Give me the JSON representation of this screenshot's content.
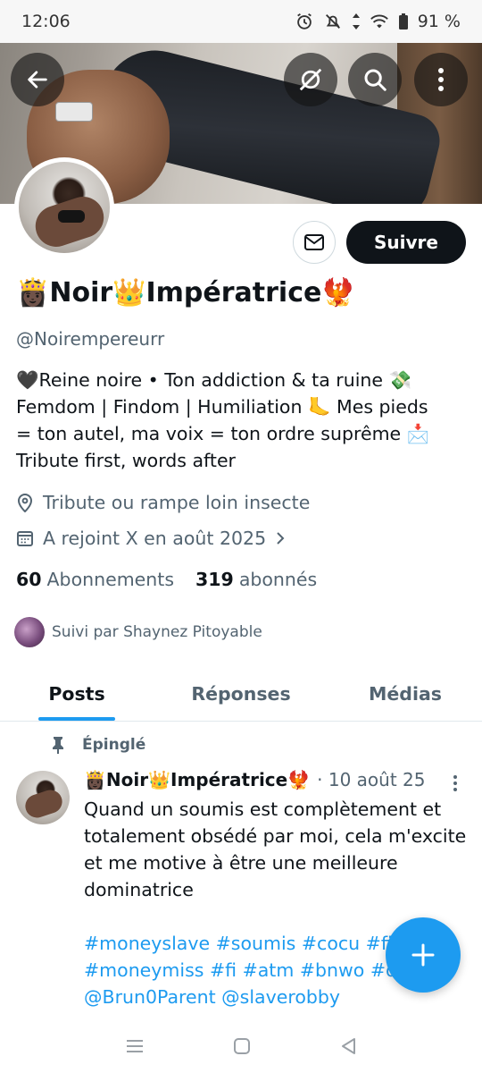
{
  "status_bar": {
    "time": "12:06",
    "battery": "91 %"
  },
  "profile": {
    "display_name": "👸🏿Noir👑Impératrice🐦‍🔥",
    "handle": "@Noirempereurr",
    "bio_lines": [
      "🖤Reine noire • Ton addiction & ta ruine 💸",
      "Femdom | Findom | Humiliation 🦶 Mes pieds",
      "= ton autel, ma voix = ton ordre suprême 📩",
      "Tribute first, words after"
    ],
    "location": "Tribute ou rampe loin insecte",
    "joined": "A rejoint X en août 2025",
    "following_count": "60",
    "following_label": "Abonnements",
    "followers_count": "319",
    "followers_label": "abonnés",
    "followed_by": "Suivi par Shaynez Pitoyable",
    "follow_button": "Suivre"
  },
  "tabs": [
    {
      "label": "Posts",
      "active": true
    },
    {
      "label": "Réponses",
      "active": false
    },
    {
      "label": "Médias",
      "active": false
    }
  ],
  "post": {
    "pinned_label": "Épinglé",
    "author": "👸🏿Noir👑Impératrice🐦‍🔥",
    "date": "· 10 août 25",
    "text_lines": [
      "Quand un soumis est complètement et",
      "totalement obsédé par moi, cela m'excite",
      "et me motive à être une meilleure",
      "dominatrice"
    ],
    "hashtag_lines": [
      "#moneyslave #soumis #cocu #fi",
      "#moneymiss #fi #atm #bnwo #d",
      "@Brun0Parent @slaverobby"
    ]
  },
  "icons": {
    "back": "arrow-left-icon",
    "hide": "eye-slash-icon",
    "search": "search-icon",
    "more": "more-vertical-icon",
    "message": "envelope-icon",
    "location": "location-pin-icon",
    "calendar": "calendar-icon",
    "pin": "pin-icon",
    "compose": "plus-icon"
  },
  "colors": {
    "accent": "#1d9bf0",
    "text": "#0f1419",
    "secondary": "#536471"
  }
}
